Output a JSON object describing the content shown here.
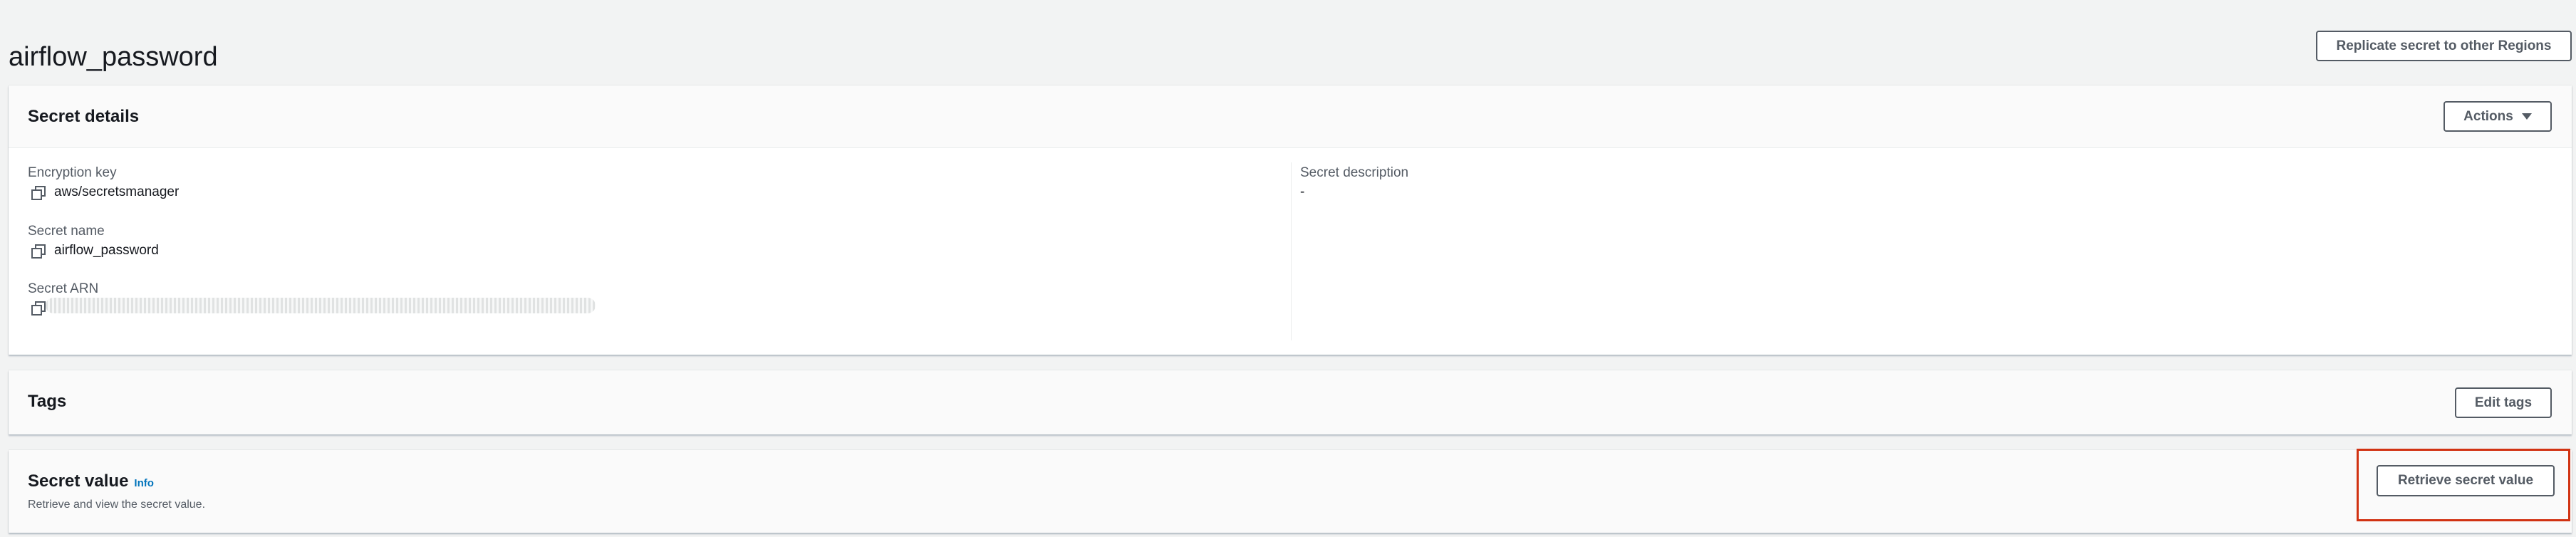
{
  "page": {
    "title": "airflow_password",
    "replicate_button": "Replicate secret to other Regions"
  },
  "secret_details": {
    "title": "Secret details",
    "actions_button": "Actions",
    "encryption_key": {
      "label": "Encryption key",
      "value": "aws/secretsmanager"
    },
    "secret_name": {
      "label": "Secret name",
      "value": "airflow_password"
    },
    "secret_arn": {
      "label": "Secret ARN",
      "value": ""
    },
    "secret_description": {
      "label": "Secret description",
      "value": "-"
    }
  },
  "tags": {
    "title": "Tags",
    "edit_button": "Edit tags"
  },
  "secret_value": {
    "title": "Secret value",
    "info_link": "Info",
    "description": "Retrieve and view the secret value.",
    "retrieve_button": "Retrieve secret value"
  },
  "colors": {
    "background": "#f2f3f3",
    "border_button": "#545b64",
    "link": "#0073bb",
    "highlight": "#d13212"
  }
}
